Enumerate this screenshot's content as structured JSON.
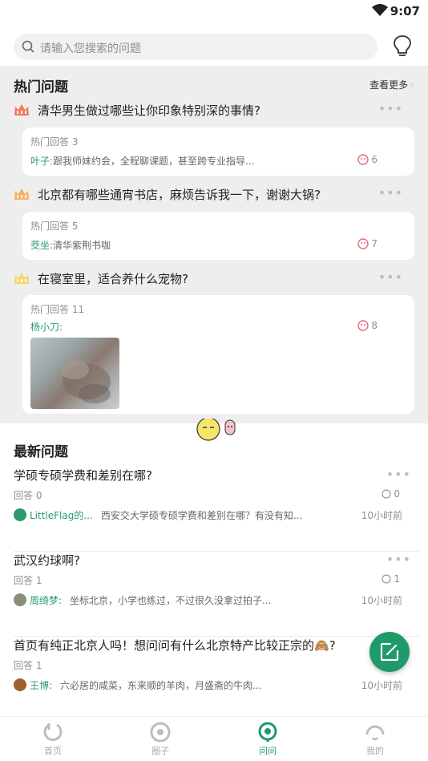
{
  "status_bar": {
    "time": "9:07"
  },
  "search": {
    "placeholder": "请输入您搜索的问题"
  },
  "hot": {
    "title": "热门问题",
    "more": "查看更多",
    "items": [
      {
        "question": "清华男生做过哪些让你印象特别深的事情?",
        "answer_count": "热门回答 3",
        "author": "叶子:",
        "answer": "跟我师妹约会，全程聊课题，甚至跨专业指导...",
        "likes": "6",
        "crown_color": "#f07b5a"
      },
      {
        "question": "北京都有哪些通宵书店，麻烦告诉我一下，谢谢大锅?",
        "answer_count": "热门回答 5",
        "author": "茭坐:",
        "answer": "清华紫荆书咖",
        "likes": "7",
        "crown_color": "#f4b267"
      },
      {
        "question": "在寝室里，适合养什么宠物?",
        "answer_count": "热门回答 11",
        "author": "杨小刀:",
        "answer": "",
        "likes": "8",
        "crown_color": "#f5d66b"
      }
    ]
  },
  "newest": {
    "title": "最新问题",
    "items": [
      {
        "question": "学硕专硕学费和差别在哪?",
        "answers": "回答 0",
        "likes": "0",
        "author": "LittleFlag的...",
        "answer": "西安交大学硕专硕学费和差别在哪？有没有知...",
        "time": "10小时前",
        "avatar_color": "#2a9a6c"
      },
      {
        "question": "武汉约球啊?",
        "answers": "回答 1",
        "likes": "1",
        "author": "周绮梦:",
        "answer": "坐标北京，小学也练过，不过很久没拿过拍子...",
        "time": "10小时前",
        "avatar_color": "#8a8f7a"
      },
      {
        "question": "首页有纯正北京人吗！想问问有什么北京特产比较正宗的🙈?",
        "answers": "回答 1",
        "likes": "",
        "author": "王博:",
        "answer": "六必居的咸菜，东来顺的羊肉，月盛斋的牛肉...",
        "time": "10小时前",
        "avatar_color": "#a0622d"
      }
    ]
  },
  "tabs": [
    {
      "label": "首页"
    },
    {
      "label": "圈子"
    },
    {
      "label": "问问"
    },
    {
      "label": "我的"
    }
  ],
  "colors": {
    "accent": "#1f9a6a",
    "hot_bg": "#eeeeee"
  }
}
